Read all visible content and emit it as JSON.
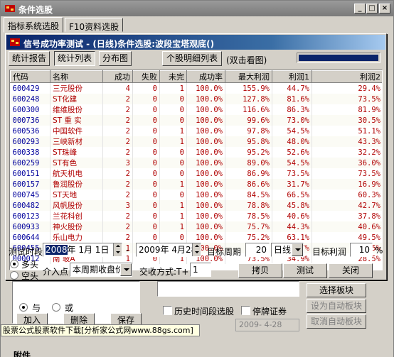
{
  "outer": {
    "title": "条件选股",
    "tabs": [
      "指标系统选股",
      "F10资料选股"
    ],
    "bg": {
      "logic_and": "与",
      "logic_or": "或",
      "add": "加入",
      "delete": "删除",
      "save": "保存",
      "select_board": "选择板块",
      "auto_board_1": "设为自动板块",
      "auto_board_2": "取消自动板块",
      "history_label": "历史时间段选股",
      "suspended_label": "停牌证券",
      "history_date": "2009- 4-28",
      "status_strip": "股票公式股票软件下载[分析家公式网www.88gs.com]",
      "bottom_label": "附件"
    }
  },
  "dialog": {
    "title": "信号成功率测试 - (日线)条件选股:波段宝塔观底()",
    "buttons": {
      "stats_report": "统计报告",
      "stats_list": "统计列表",
      "distribution": "分布图",
      "stock_detail": "个股明细列表",
      "copy": "拷贝",
      "test": "测试",
      "close": "关闭"
    },
    "hint": "(双击看图)",
    "progress": 1.0,
    "table": {
      "headers": [
        "代码",
        "名称",
        "成功",
        "失败",
        "未完",
        "成功率",
        "最大利润",
        "利润1",
        "利润2"
      ],
      "rows": [
        [
          "600429",
          "三元股份",
          "4",
          "0",
          "1",
          "100.0%",
          "155.9%",
          "44.7%",
          "29.4%"
        ],
        [
          "600248",
          "ST化建",
          "2",
          "0",
          "0",
          "100.0%",
          "127.8%",
          "81.6%",
          "73.5%"
        ],
        [
          "600300",
          "维维股份",
          "2",
          "0",
          "0",
          "100.0%",
          "116.6%",
          "86.3%",
          "81.9%"
        ],
        [
          "000736",
          "ST 重 实",
          "2",
          "0",
          "0",
          "100.0%",
          "99.6%",
          "73.0%",
          "30.5%"
        ],
        [
          "600536",
          "中国软件",
          "2",
          "0",
          "1",
          "100.0%",
          "97.8%",
          "54.5%",
          "51.1%"
        ],
        [
          "600293",
          "三峡新材",
          "2",
          "0",
          "1",
          "100.0%",
          "95.8%",
          "48.0%",
          "43.3%"
        ],
        [
          "600338",
          "ST珠峰",
          "2",
          "0",
          "0",
          "100.0%",
          "95.2%",
          "52.6%",
          "32.2%"
        ],
        [
          "600259",
          "ST有色",
          "3",
          "0",
          "0",
          "100.0%",
          "89.0%",
          "54.5%",
          "36.0%"
        ],
        [
          "600151",
          "航天机电",
          "2",
          "0",
          "0",
          "100.0%",
          "86.9%",
          "73.5%",
          "73.5%"
        ],
        [
          "600157",
          "鲁润股份",
          "2",
          "0",
          "1",
          "100.0%",
          "86.6%",
          "31.7%",
          "16.9%"
        ],
        [
          "000745",
          "ST天地",
          "2",
          "0",
          "0",
          "100.0%",
          "84.5%",
          "66.5%",
          "60.3%"
        ],
        [
          "600482",
          "风帆股份",
          "3",
          "0",
          "1",
          "100.0%",
          "78.8%",
          "45.8%",
          "42.7%"
        ],
        [
          "600123",
          "兰花科创",
          "2",
          "0",
          "1",
          "100.0%",
          "78.5%",
          "40.6%",
          "37.8%"
        ],
        [
          "600933",
          "神火股份",
          "2",
          "0",
          "1",
          "100.0%",
          "75.7%",
          "44.3%",
          "40.6%"
        ],
        [
          "600644",
          "乐山电力",
          "2",
          "0",
          "0",
          "100.0%",
          "75.2%",
          "63.1%",
          "49.5%"
        ],
        [
          "600455",
          "交大博通",
          "1",
          "0",
          "0",
          "100.0%",
          "73.7%",
          "73.7%",
          "49.5%"
        ],
        [
          "000012",
          "南  玻A",
          "1",
          "0",
          "1",
          "100.0%",
          "73.5%",
          "34.9%",
          "28.5%"
        ]
      ]
    },
    "controls": {
      "period_label": "测试时段",
      "start_year": "2008",
      "start_rest": "年  1月  1日",
      "dash": "-",
      "end_date": "2009年  4月28日",
      "target_period_label": "目标周期",
      "target_period_value": "20",
      "period_unit": "日线",
      "target_profit_label": "目标利润",
      "target_profit_value": "10",
      "percent": "%",
      "long_label": "多头",
      "short_label": "空头",
      "entry_label": "介入点",
      "entry_value": "本周期收盘价",
      "trade_mode_label": "交收方式:T+",
      "trade_mode_value": "1"
    }
  }
}
